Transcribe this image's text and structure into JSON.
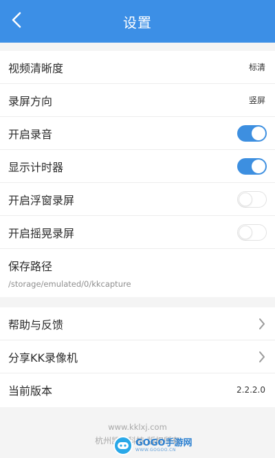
{
  "header": {
    "title": "设置"
  },
  "settings": {
    "items": [
      {
        "label": "视频清晰度",
        "value": "标清"
      },
      {
        "label": "录屏方向",
        "value": "竖屏"
      },
      {
        "label": "开启录音",
        "toggle": true
      },
      {
        "label": "显示计时器",
        "toggle": true
      },
      {
        "label": "开启浮窗录屏",
        "toggle": false
      },
      {
        "label": "开启摇晃录屏",
        "toggle": false
      },
      {
        "label": "保存路径",
        "sub": "/storage/emulated/0/kkcapture"
      }
    ]
  },
  "about": {
    "items": [
      {
        "label": "帮助与反馈"
      },
      {
        "label": "分享KK录像机"
      },
      {
        "label": "当前版本",
        "value": "2.2.2.0"
      }
    ]
  },
  "footer": {
    "website": "www.kklxj.com",
    "copyright": "杭州凯聪科技 版权所有"
  },
  "watermark": {
    "brand": "GOGO手游网",
    "sub": "WWW.GOGOO.CN"
  },
  "colors": {
    "accent": "#3c8fe6",
    "toggle_on": "#3d8fe0",
    "background": "#f4f4f4"
  },
  "icons": {
    "back": "chevron-left-icon",
    "row_arrow": "chevron-right-icon"
  }
}
